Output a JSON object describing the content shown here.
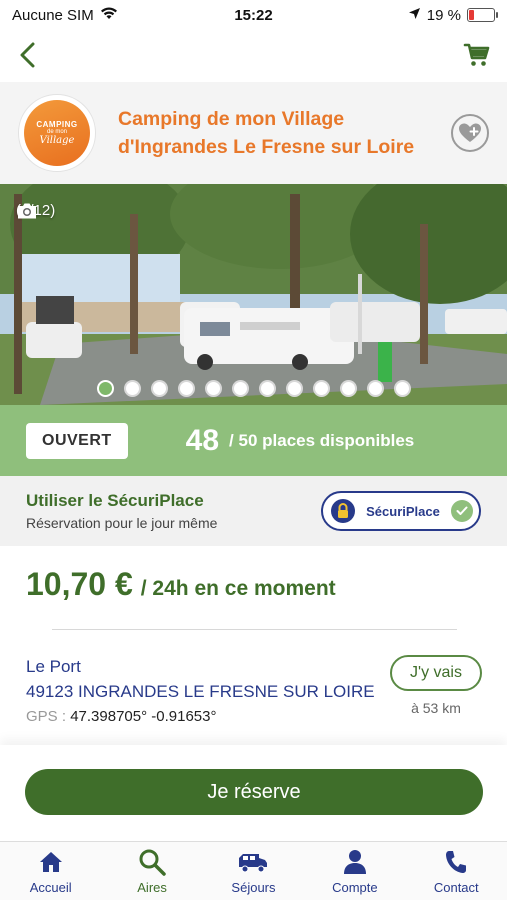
{
  "status_bar": {
    "carrier": "Aucune SIM",
    "time": "15:22",
    "battery": "19 %",
    "battery_level": 0.19
  },
  "header": {
    "title": "Camping de mon Village d'Ingrandes Le Fresne sur Loire",
    "logo_text": [
      "CAMPING",
      "de mon",
      "Village"
    ]
  },
  "photo": {
    "counter": "(1/12)",
    "total": 12,
    "current": 1
  },
  "availability": {
    "status": "OUVERT",
    "count": "48",
    "text": "/ 50 places disponibles"
  },
  "securiplace": {
    "title": "Utiliser le SécuriPlace",
    "subtitle": "Réservation pour le jour même",
    "pill_label": "SécuriPlace"
  },
  "price": {
    "amount": "10,70 €",
    "unit": "/ 24h en ce moment"
  },
  "address": {
    "line1": "Le Port",
    "line2": "49123 INGRANDES LE FRESNE SUR LOIRE",
    "gps_label": "GPS :",
    "gps_value": "47.398705° -0.91653°",
    "go_label": "J'y vais",
    "distance": "à 53 km"
  },
  "reserve_label": "Je réserve",
  "tabs": [
    {
      "label": "Accueil",
      "icon": "home-icon"
    },
    {
      "label": "Aires",
      "icon": "search-icon"
    },
    {
      "label": "Séjours",
      "icon": "van-icon"
    },
    {
      "label": "Compte",
      "icon": "user-icon"
    },
    {
      "label": "Contact",
      "icon": "phone-icon"
    }
  ],
  "colors": {
    "primary_green": "#3f6e2a",
    "light_green": "#8fbf7c",
    "orange": "#e8782a",
    "navy": "#283a8a"
  }
}
